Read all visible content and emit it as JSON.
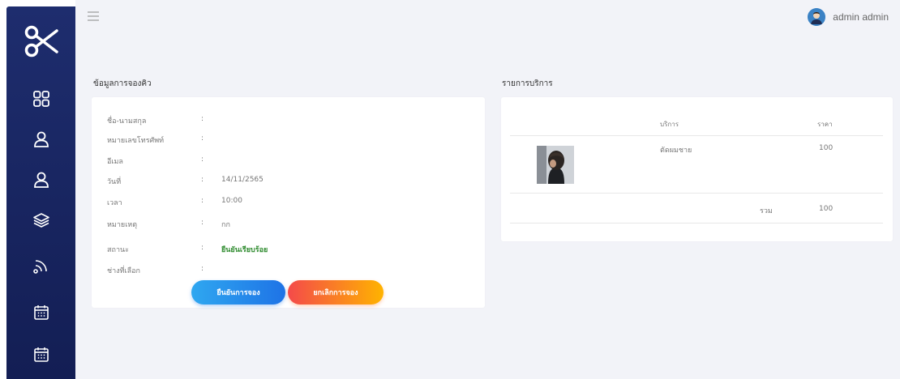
{
  "topbar": {
    "user_name": "admin admin"
  },
  "sidebar": {
    "items": [
      {
        "icon": "grid-icon"
      },
      {
        "icon": "user-icon"
      },
      {
        "icon": "user-icon"
      },
      {
        "icon": "layers-icon"
      },
      {
        "icon": "rss-icon"
      },
      {
        "icon": "calendar-icon"
      },
      {
        "icon": "calendar-icon"
      }
    ]
  },
  "booking": {
    "title": "ข้อมูลการจองคิว",
    "fields": [
      {
        "label": "ชื่อ-นามสกุล",
        "colon": ":",
        "value": ""
      },
      {
        "label": "หมายเลขโทรศัพท์",
        "colon": ":",
        "value": ""
      },
      {
        "label": "อีเมล",
        "colon": ":",
        "value": ""
      },
      {
        "label": "วันที่",
        "colon": ":",
        "value": "14/11/2565"
      },
      {
        "label": "เวลา",
        "colon": ":",
        "value": "10:00"
      },
      {
        "label": "หมายเหตุ",
        "colon": ":",
        "value": "กก"
      },
      {
        "label": "สถานะ",
        "colon": ":",
        "value": "ยืนยันเรียบร้อย"
      },
      {
        "label": "ช่างที่เลือก",
        "colon": ":",
        "value": ""
      }
    ],
    "confirm_label": "ยืนยันการจอง",
    "cancel_label": "ยกเลิกการจอง"
  },
  "services": {
    "title": "รายการบริการ",
    "col_service": "บริการ",
    "col_price": "ราคา",
    "rows": [
      {
        "name": "ตัดผมชาย",
        "price": "100"
      }
    ],
    "total_label": "รวม",
    "total_value": "100"
  },
  "colors": {
    "sidebar": "#1e2d6e",
    "status_ok": "#2e8b2e",
    "confirm_button": "#1e73e6",
    "cancel_button": "#f44a4a"
  }
}
